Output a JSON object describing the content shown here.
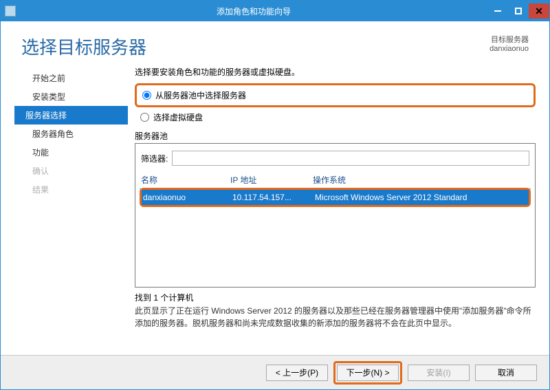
{
  "window": {
    "title": "添加角色和功能向导"
  },
  "header": {
    "heading": "选择目标服务器",
    "meta_label": "目标服务器",
    "meta_value": "danxiaonuo"
  },
  "sidebar": {
    "items": [
      {
        "label": "开始之前",
        "state": "normal"
      },
      {
        "label": "安装类型",
        "state": "normal"
      },
      {
        "label": "服务器选择",
        "state": "selected"
      },
      {
        "label": "服务器角色",
        "state": "normal"
      },
      {
        "label": "功能",
        "state": "normal"
      },
      {
        "label": "确认",
        "state": "disabled"
      },
      {
        "label": "结果",
        "state": "disabled"
      }
    ]
  },
  "content": {
    "instruction": "选择要安装角色和功能的服务器或虚拟硬盘。",
    "radio_pool": "从服务器池中选择服务器",
    "radio_vhd": "选择虚拟硬盘",
    "pool_label": "服务器池",
    "filter_label": "筛选器:",
    "filter_value": "",
    "columns": {
      "name": "名称",
      "ip": "IP 地址",
      "os": "操作系统"
    },
    "row": {
      "name": "danxiaonuo",
      "ip": "10.117.54.157...",
      "os": "Microsoft Windows Server 2012 Standard"
    },
    "found": "找到 1 个计算机",
    "description": "此页显示了正在运行 Windows Server 2012 的服务器以及那些已经在服务器管理器中使用\"添加服务器\"命令所添加的服务器。脱机服务器和尚未完成数据收集的新添加的服务器将不会在此页中显示。"
  },
  "footer": {
    "prev": "< 上一步(P)",
    "next": "下一步(N) >",
    "install": "安装(I)",
    "cancel": "取消"
  }
}
